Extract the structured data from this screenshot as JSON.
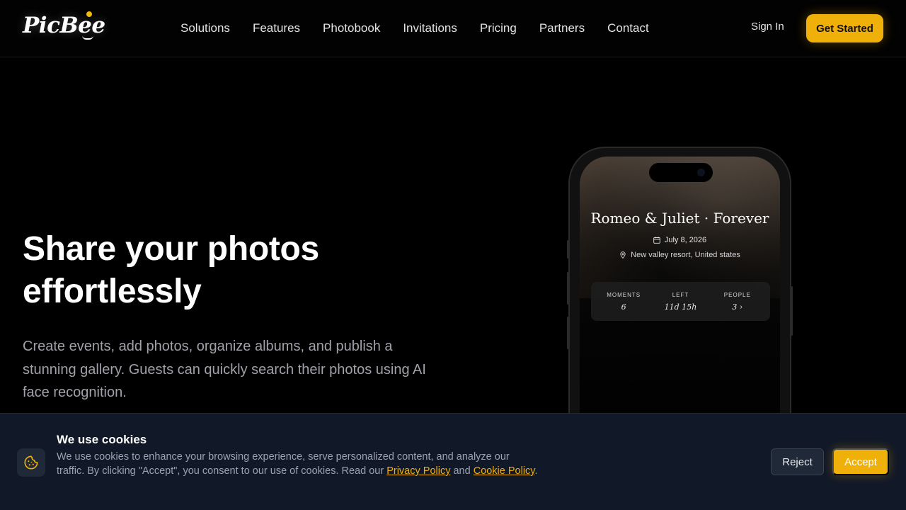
{
  "header": {
    "logo": "PicBee",
    "nav": [
      "Solutions",
      "Features",
      "Photobook",
      "Invitations",
      "Pricing",
      "Partners",
      "Contact"
    ],
    "sign_in": "Sign In",
    "get_started": "Get Started"
  },
  "hero": {
    "title_line1": "Share your photos",
    "title_line2": "effortlessly",
    "subtitle": "Create events, add photos, organize albums, and publish a stunning gallery. Guests can quickly search their photos using AI face recognition."
  },
  "phone": {
    "event_title": "Romeo & Juliet · Forever",
    "date": "July 8, 2026",
    "location": "New valley resort, United states",
    "stats": [
      {
        "label": "MOMENTS",
        "value": "6"
      },
      {
        "label": "LEFT",
        "value": "11d 15h"
      },
      {
        "label": "PEOPLE",
        "value": "3 ›"
      }
    ]
  },
  "cookie": {
    "title": "We use cookies",
    "text_before": "We use cookies to enhance your browsing experience, serve personalized content, and analyze our traffic. By clicking \"Accept\", you consent to our use of cookies. Read our ",
    "privacy_link": "Privacy Policy",
    "and": " and ",
    "cookie_link": "Cookie Policy",
    "period": ".",
    "reject": "Reject",
    "accept": "Accept"
  },
  "colors": {
    "accent": "#f0b00a",
    "background": "#000000",
    "banner": "#111827"
  }
}
